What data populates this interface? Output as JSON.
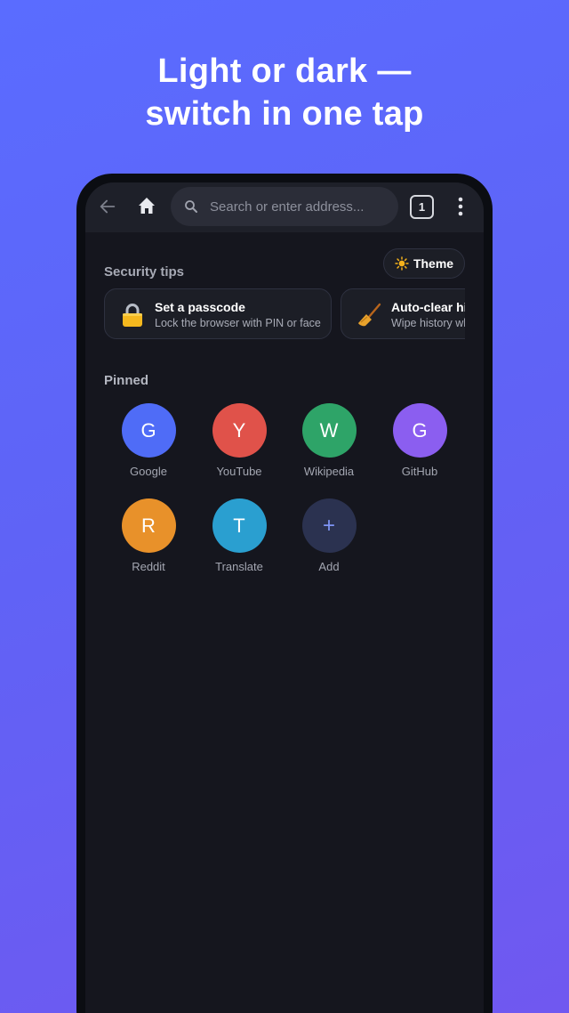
{
  "headline": {
    "line1": "Light or dark —",
    "line2": "switch in one tap"
  },
  "toolbar": {
    "back_icon": "arrow-left-icon",
    "home_icon": "home-icon",
    "search_placeholder": "Search or enter address...",
    "tab_count": "1",
    "more_icon": "vertical-dots-icon"
  },
  "security": {
    "title": "Security tips",
    "theme_label": "Theme",
    "theme_icon": "sun-icon",
    "tips": [
      {
        "icon": "lock-icon",
        "title": "Set a passcode",
        "subtitle": "Lock the browser with PIN or face"
      },
      {
        "icon": "broom-icon",
        "title": "Auto-clear history",
        "subtitle": "Wipe history when closed"
      }
    ]
  },
  "pinned": {
    "title": "Pinned",
    "items": [
      {
        "letter": "G",
        "label": "Google",
        "color": "#4f6cf7"
      },
      {
        "letter": "Y",
        "label": "YouTube",
        "color": "#e0524a"
      },
      {
        "letter": "W",
        "label": "Wikipedia",
        "color": "#2ea468"
      },
      {
        "letter": "G",
        "label": "GitHub",
        "color": "#8b5ef0"
      },
      {
        "letter": "R",
        "label": "Reddit",
        "color": "#e8912a"
      },
      {
        "letter": "T",
        "label": "Translate",
        "color": "#2a9fd0"
      },
      {
        "letter": "+",
        "label": "Add",
        "color": "#2b3250"
      }
    ]
  }
}
